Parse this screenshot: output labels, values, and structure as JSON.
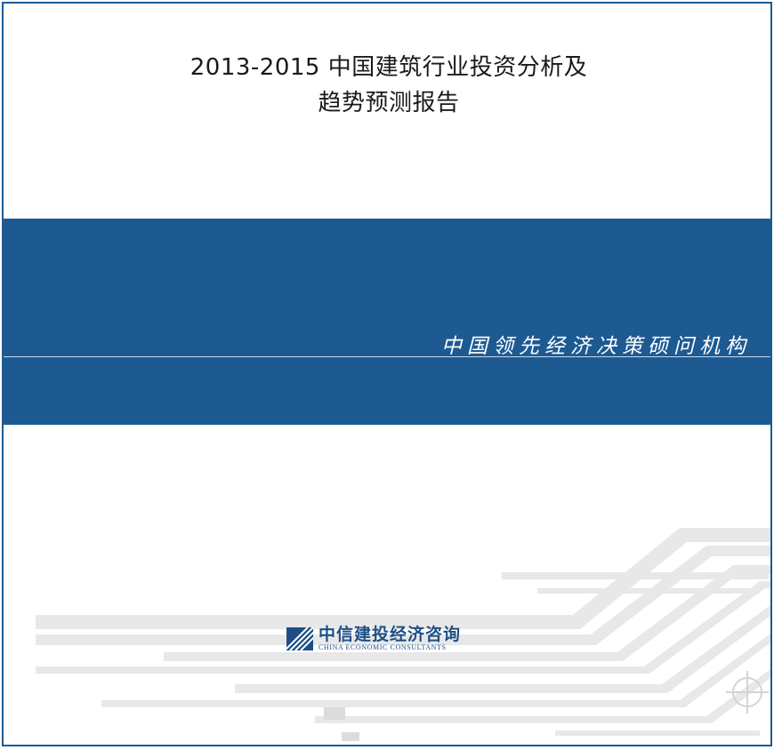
{
  "cover": {
    "title_line1": "2013-2015 中国建筑行业投资分析及",
    "title_line2": "趋势预测报告",
    "slogan": "中国领先经济决策硕问机构"
  },
  "logo": {
    "name_cn": "中信建投经济咨询",
    "name_en": "CHINA ECONOMIC CONSULTANTS"
  },
  "colors": {
    "brand_blue": "#1d5a92",
    "decor_gray": "#e6e6e6"
  },
  "icons": {
    "logo_mark": "striped-square-logo-icon",
    "crosshair": "crosshair-circle-icon"
  }
}
